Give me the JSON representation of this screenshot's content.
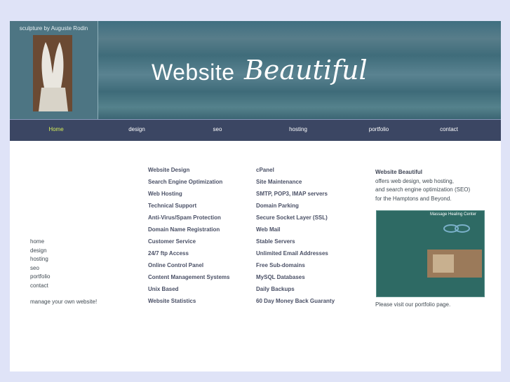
{
  "header": {
    "caption": "sculpture by Auguste Rodin",
    "title_main": "Website",
    "title_script": "Beautiful"
  },
  "nav": {
    "items": [
      "Home",
      "design",
      "seo",
      "hosting",
      "portfolio",
      "contact"
    ]
  },
  "left_nav": {
    "items": [
      "home",
      "design",
      "hosting",
      "seo",
      "portfolio",
      "contact"
    ],
    "note": "manage your own website!"
  },
  "services": {
    "col1": [
      "Website Design",
      "Search Engine Optimization",
      "Web Hosting",
      "Technical Support",
      "Anti-Virus/Spam Protection",
      "Domain Name Registration",
      "Customer Service",
      "24/7 ftp Access",
      "Online Control Panel",
      "Content Management Systems",
      "Unix Based",
      "Website Statistics"
    ],
    "col2": [
      "cPanel",
      "Site Maintenance",
      "SMTP, POP3, IMAP servers",
      "Domain Parking",
      "Secure Socket Layer (SSL)",
      "Web Mail",
      "Stable Servers",
      "Unlimited Email Addresses",
      "Free Sub-domains",
      "MySQL Databases",
      "Daily Backups",
      "60 Day Money Back Guaranty"
    ]
  },
  "right": {
    "heading": "Website Beautiful",
    "lines": [
      "offers web design, web hosting,",
      "and search engine optimization (SEO)",
      "for the Hamptons and Beyond."
    ],
    "thumb_title": "Massage Healing Center",
    "visit": "Please visit our portfolio page."
  }
}
